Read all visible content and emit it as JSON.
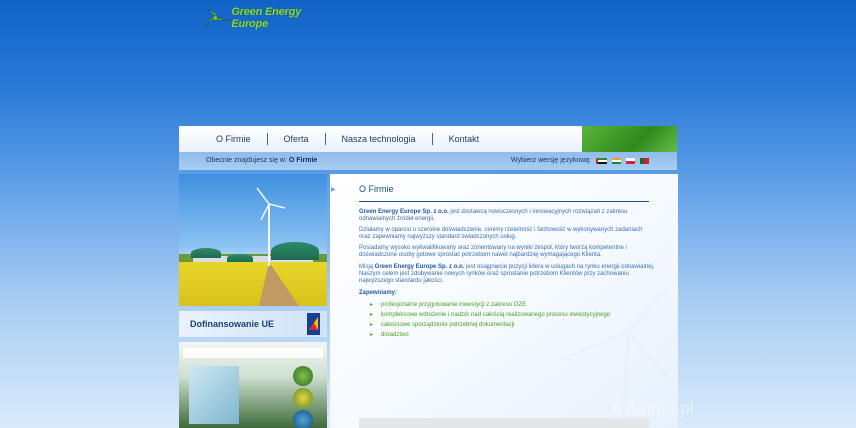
{
  "brand": {
    "name": "Green Energy Europe",
    "accent": "#8bd83a"
  },
  "nav": {
    "items": [
      {
        "label": "O Firmie"
      },
      {
        "label": "Oferta"
      },
      {
        "label": "Nasza technologia"
      },
      {
        "label": "Kontakt"
      }
    ]
  },
  "breadcrumb": {
    "prefix": "Obecnie znajdujesz się w:",
    "current": "O Firmie"
  },
  "language": {
    "label": "Wybierz wersję językową:",
    "flags": [
      "arabic-flag",
      "indian-flag",
      "polish-flag",
      "portuguese-flag"
    ]
  },
  "sidebar": {
    "funding_label": "Dofinansowanie UE"
  },
  "content": {
    "title": "O Firmie",
    "p1_company": "Green Energy Europe Sp. z o.o.",
    "p1_rest": " jest dostawcą nowoczesnych i innowacyjnych rozwiązań z zakresu odnawialnych źródeł energii.",
    "p2": "Działamy w oparciu o szerokie doświadczenie, cenimy rzetelność i fachowość w wykonywanych zadaniach oraz zapewniamy najwyższy standard świadczonych usług.",
    "p3": "Posiadamy wysoko wykwalifikowany oraz zorientowany na wyniki zespół, który tworzą kompetentne i doświadczone osoby gotowe sprostać potrzebom nawet najbardziej wymagającego Klienta.",
    "p4_prefix": "Misją ",
    "p4_company": "Green Energy Europe Sp. z o.o.",
    "p4_rest": " jest osiągnięcie pozycji lidera w usługach na rynku energii odnawialnej. Naszym celem jest zdobywanie nowych rynków oraz sprostanie potrzebom Klientów przy zachowaniu najwyższego standardu jakości.",
    "guarantee_label": "Zapewniamy:",
    "guarantees": [
      "profesjonalne przygotowanie inwestycji z zakresu OZE",
      "kompleksowe wdrożenie i nadzór nad całością realizowanego procesu inwestycyjnego",
      "całościowe sporządzenie potrzebnej dokumentacji",
      "doradztwo"
    ]
  },
  "watermark": "ostatnio.pl"
}
